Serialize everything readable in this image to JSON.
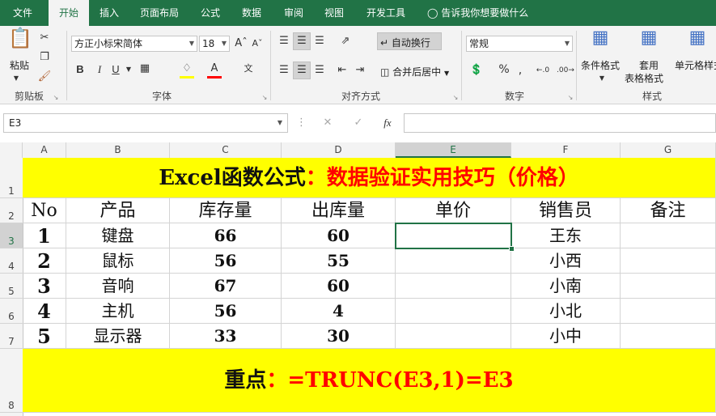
{
  "ribbon_tabs": [
    "文件",
    "开始",
    "插入",
    "页面布局",
    "公式",
    "数据",
    "审阅",
    "视图",
    "开发工具"
  ],
  "active_tab": "开始",
  "tell_me": "告诉我你想要做什么",
  "clipboard": {
    "paste": "粘贴",
    "group": "剪贴板"
  },
  "font": {
    "name": "方正小标宋简体",
    "size": "18",
    "group": "字体",
    "bold": "B",
    "italic": "I",
    "underline": "U"
  },
  "alignment": {
    "wrap": "自动换行",
    "merge": "合并后居中",
    "group": "对齐方式"
  },
  "number": {
    "format": "常规",
    "group": "数字",
    "percent": "%"
  },
  "styles": {
    "conditional": "条件格式",
    "table_format_1": "套用",
    "table_format_2": "表格格式",
    "cell_styles": "单元格样式",
    "group": "样式"
  },
  "formula_bar": {
    "name_box": "E3",
    "fx": "fx",
    "formula": ""
  },
  "columns": [
    "A",
    "B",
    "C",
    "D",
    "E",
    "F",
    "G"
  ],
  "rows": [
    "1",
    "2",
    "3",
    "4",
    "5",
    "6",
    "7",
    "8"
  ],
  "sheet": {
    "title_black": "Excel函数公式",
    "title_red": "：数据验证实用技巧（价格）",
    "headers": [
      "No",
      "产品",
      "库存量",
      "出库量",
      "单价",
      "销售员",
      "备注"
    ],
    "data": [
      [
        "1",
        "键盘",
        "66",
        "60",
        "",
        "王东",
        ""
      ],
      [
        "2",
        "鼠标",
        "56",
        "55",
        "",
        "小西",
        ""
      ],
      [
        "3",
        "音响",
        "67",
        "60",
        "",
        "小南",
        ""
      ],
      [
        "4",
        "主机",
        "56",
        "4",
        "",
        "小北",
        ""
      ],
      [
        "5",
        "显示器",
        "33",
        "30",
        "",
        "小中",
        ""
      ]
    ],
    "footer_black": "重点",
    "footer_red": "：=TRUNC(E3,1)=E3"
  },
  "colors": {
    "excel_green": "#217346",
    "highlight_yellow": "#ffff00",
    "red_text": "#ff0000"
  }
}
